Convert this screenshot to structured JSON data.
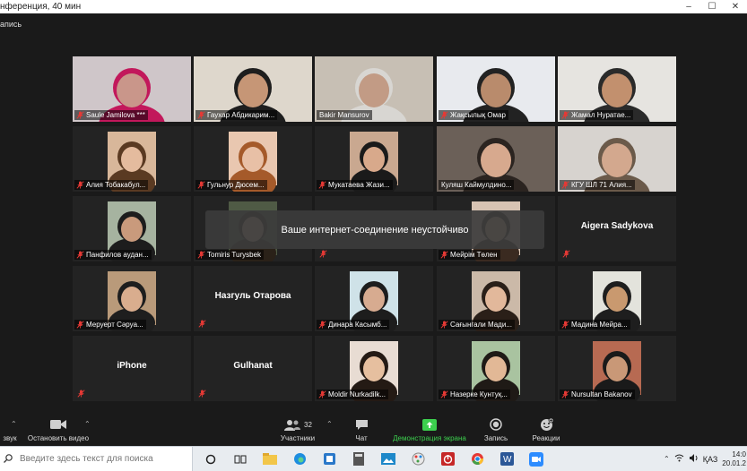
{
  "window": {
    "title": "нференция, 40 мин",
    "min": "–",
    "max": "☐",
    "close": "✕"
  },
  "recording": {
    "label": "апись"
  },
  "notice": "Ваше интернет-соединение неустойчиво",
  "tiles": [
    {
      "name": "Saule Jamilova ***",
      "kind": "video",
      "bg": "#cfc6c9",
      "skin": "#c9968a",
      "hair": "#c2185b",
      "muted": true
    },
    {
      "name": "Гаухар Абдикарим...",
      "kind": "video",
      "bg": "#ded7cc",
      "skin": "#c69676",
      "hair": "#1e1e1e",
      "muted": true
    },
    {
      "name": "Bakir Mansurov",
      "kind": "video",
      "bg": "#c7bfb4",
      "skin": "#c29b85",
      "hair": "#d8d6d2",
      "muted": false
    },
    {
      "name": "Жақсылық Омар",
      "kind": "video",
      "bg": "#e8eaee",
      "skin": "#b98b6c",
      "hair": "#222",
      "muted": true
    },
    {
      "name": "Жамал Нуратае...",
      "kind": "video",
      "bg": "#e6e4e0",
      "skin": "#c2906e",
      "hair": "#2a2a2a",
      "muted": true
    },
    {
      "name": "Алия Тобакабул...",
      "kind": "photo",
      "bg": "#d8b79a",
      "skin": "#e4bb9e",
      "hair": "#5a3a22",
      "muted": true
    },
    {
      "name": "Гульнур Дюсем...",
      "kind": "photo",
      "bg": "#e9c7b0",
      "skin": "#e8c0a6",
      "hair": "#a55a2a",
      "muted": true
    },
    {
      "name": "Мукатаева Жази...",
      "kind": "photo",
      "bg": "#c9a890",
      "skin": "#d8a98b",
      "hair": "#1a1a1a",
      "muted": true
    },
    {
      "name": "Куляш Каймулдино...",
      "kind": "video",
      "bg": "#6b6058",
      "skin": "#d7a98e",
      "hair": "#2b2420",
      "muted": false,
      "active": true
    },
    {
      "name": "КГУ ШЛ 71 Алия...",
      "kind": "video",
      "bg": "#d7d3cf",
      "skin": "#d3a88e",
      "hair": "#6b5a4a",
      "muted": true
    },
    {
      "name": "Панфилов аудан...",
      "kind": "photo",
      "bg": "#a6b3a0",
      "skin": "#c99a7c",
      "hair": "#1d1d1d",
      "muted": true
    },
    {
      "name": "Tomiris Turysbek",
      "kind": "photo",
      "bg": "#4f5a45",
      "skin": "#d9b49a",
      "hair": "#2a2118",
      "muted": true
    },
    {
      "name": "",
      "kind": "blank",
      "muted": true
    },
    {
      "name": "Мейрім Төлен",
      "kind": "photo",
      "bg": "#d7c3b3",
      "skin": "#e1b89c",
      "hair": "#3a2a20",
      "muted": true
    },
    {
      "name": "Aigera Sadykova",
      "kind": "text",
      "muted": true
    },
    {
      "name": "Меруерт Сәруа...",
      "kind": "photo",
      "bg": "#b99a7a",
      "skin": "#d9ad8e",
      "hair": "#1e1e1e",
      "muted": true
    },
    {
      "name": "Назгуль Отарова",
      "kind": "text",
      "muted": true
    },
    {
      "name": "Динара Касымб...",
      "kind": "photo",
      "bg": "#cfe2e8",
      "skin": "#d7ab90",
      "hair": "#1d1d1d",
      "muted": true
    },
    {
      "name": "Сағынгали Мади...",
      "kind": "photo",
      "bg": "#cbb9a8",
      "skin": "#e2b89b",
      "hair": "#2a1f18",
      "muted": true
    },
    {
      "name": "Мадина Мейра...",
      "kind": "photo",
      "bg": "#e3e3dc",
      "skin": "#c9996f",
      "hair": "#1e1e1e",
      "muted": true
    },
    {
      "name": "iPhone",
      "kind": "text",
      "muted": true
    },
    {
      "name": "Gulhanat",
      "kind": "text",
      "muted": true
    },
    {
      "name": "Moldir Nurkadilk...",
      "kind": "photo",
      "bg": "#e8dcd3",
      "skin": "#e6bf9f",
      "hair": "#241a14",
      "muted": true
    },
    {
      "name": "Назерке Кунтуқ...",
      "kind": "photo",
      "bg": "#a9c3a0",
      "skin": "#e2b896",
      "hair": "#1f1a16",
      "muted": true
    },
    {
      "name": "Nursultan Bakanov",
      "kind": "photo",
      "bg": "#b76a52",
      "skin": "#c99877",
      "hair": "#1a1a1a",
      "muted": true
    }
  ],
  "toolbar": {
    "audio": "звук",
    "video": "Остановить видео",
    "participants": "Участники",
    "participants_count": "32",
    "chat": "Чат",
    "share": "Демонстрация экрана",
    "record": "Запись",
    "reactions": "Реакции",
    "share_color": "#3ccf4e"
  },
  "taskbar": {
    "search_placeholder": "Введите здесь текст для поиска",
    "lang": "ҚАЗ",
    "time": "14:0",
    "date": "20.01.2"
  }
}
